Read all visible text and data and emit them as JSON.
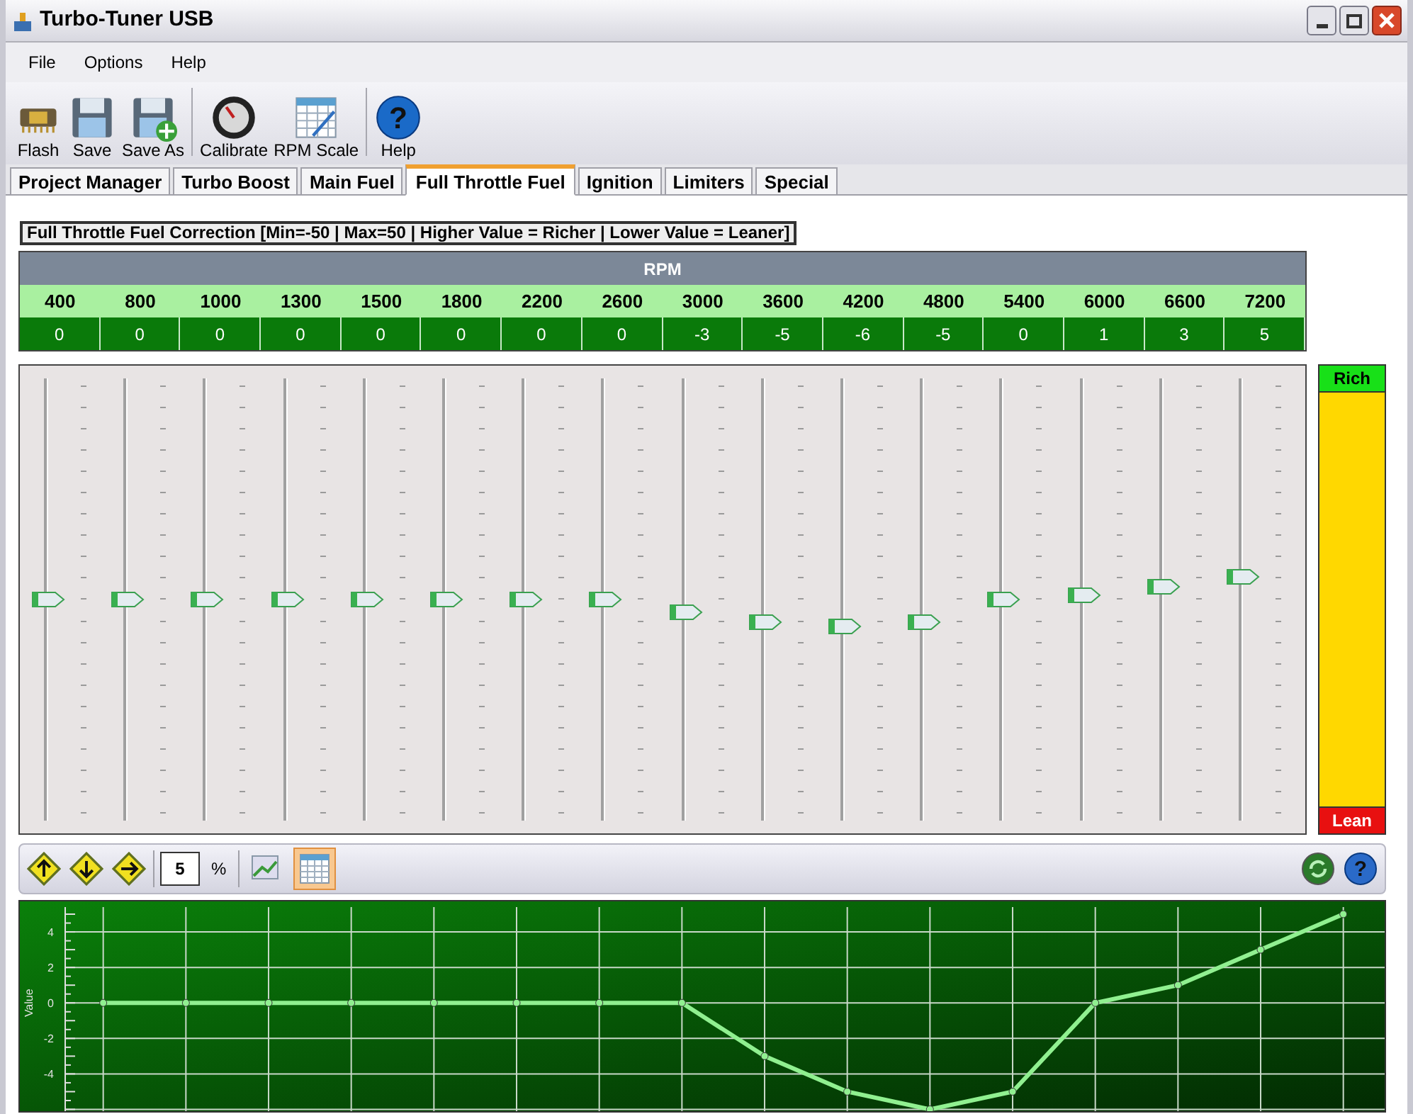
{
  "window": {
    "title": "Turbo-Tuner USB"
  },
  "menu": [
    "File",
    "Options",
    "Help"
  ],
  "toolbar": [
    [
      {
        "kind": "flash",
        "label": "Flash"
      },
      {
        "kind": "save",
        "label": "Save"
      },
      {
        "kind": "saveas",
        "label": "Save As"
      }
    ],
    [
      {
        "kind": "calibrate",
        "label": "Calibrate"
      },
      {
        "kind": "rpmscale",
        "label": "RPM Scale"
      }
    ],
    [
      {
        "kind": "help",
        "label": "Help",
        "glyph": "?"
      }
    ]
  ],
  "tabs": [
    {
      "label": "Project Manager",
      "selected": false
    },
    {
      "label": "Turbo Boost",
      "selected": false
    },
    {
      "label": "Main Fuel",
      "selected": false
    },
    {
      "label": "Full Throttle Fuel",
      "selected": true
    },
    {
      "label": "Ignition",
      "selected": false
    },
    {
      "label": "Limiters",
      "selected": false
    },
    {
      "label": "Special",
      "selected": false
    }
  ],
  "description": "Full Throttle Fuel Correction [Min=-50 | Max=50 | Higher Value = Richer | Lower Value = Leaner]",
  "rpm_table": {
    "heading": "RPM",
    "columns": [
      {
        "rpm": "400",
        "value": "0",
        "level": 0.5
      },
      {
        "rpm": "800",
        "value": "0",
        "level": 0.5
      },
      {
        "rpm": "1000",
        "value": "0",
        "level": 0.5
      },
      {
        "rpm": "1300",
        "value": "0",
        "level": 0.5
      },
      {
        "rpm": "1500",
        "value": "0",
        "level": 0.5
      },
      {
        "rpm": "1800",
        "value": "0",
        "level": 0.5
      },
      {
        "rpm": "2200",
        "value": "0",
        "level": 0.5
      },
      {
        "rpm": "2600",
        "value": "0",
        "level": 0.5
      },
      {
        "rpm": "3000",
        "value": "-3",
        "level": 0.47
      },
      {
        "rpm": "3600",
        "value": "-5",
        "level": 0.45
      },
      {
        "rpm": "4200",
        "value": "-6",
        "level": 0.44
      },
      {
        "rpm": "4800",
        "value": "-5",
        "level": 0.45
      },
      {
        "rpm": "5400",
        "value": "0",
        "level": 0.5
      },
      {
        "rpm": "6000",
        "value": "1",
        "level": 0.51
      },
      {
        "rpm": "6600",
        "value": "3",
        "level": 0.53
      },
      {
        "rpm": "7200",
        "value": "5",
        "level": 0.55
      }
    ]
  },
  "mixture_bar": {
    "top": "Rich",
    "bottom": "Lean"
  },
  "step_toolbar": {
    "buttons": [
      {
        "kind": "up"
      },
      {
        "kind": "down"
      },
      {
        "kind": "right"
      }
    ],
    "step": "5",
    "unit": "%",
    "views": [
      {
        "kind": "graph",
        "selected": false
      },
      {
        "kind": "table",
        "selected": true
      }
    ],
    "right_buttons": [
      {
        "kind": "refresh"
      },
      {
        "kind": "help",
        "glyph": "?"
      }
    ]
  },
  "chart": {
    "chart_data": {
      "type": "line",
      "ylabel": "Value",
      "categories": [
        null,
        null,
        null,
        null,
        null,
        null,
        null,
        null,
        null,
        null,
        null,
        null,
        null,
        null,
        null,
        null
      ],
      "ylim": [
        -6.1,
        5.4
      ],
      "yticks": [
        4,
        2,
        0,
        -2,
        -4
      ],
      "grid": true,
      "series": [
        {
          "color": "#90f090",
          "marker": "circle",
          "values": [
            0,
            0,
            0,
            0,
            0,
            0,
            0,
            0,
            -3,
            -5,
            -6,
            -5,
            0,
            1,
            3,
            5
          ]
        }
      ]
    }
  }
}
